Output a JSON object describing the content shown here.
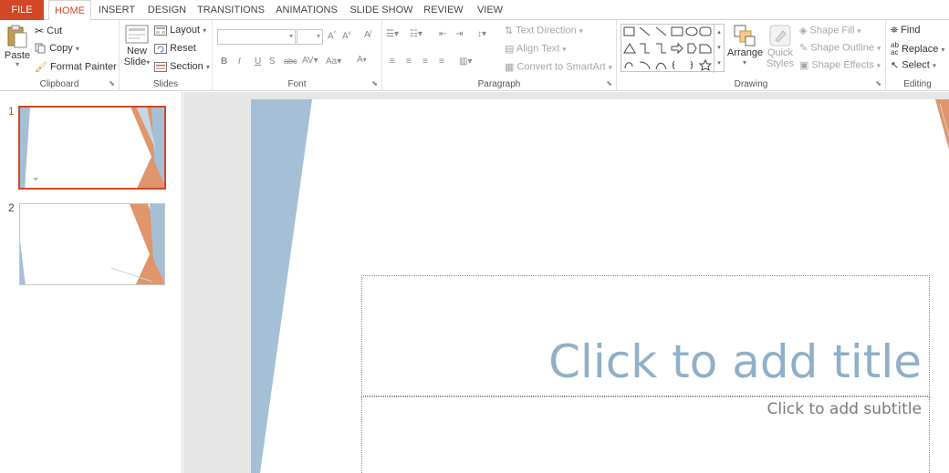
{
  "tabs": [
    "FILE",
    "HOME",
    "INSERT",
    "DESIGN",
    "TRANSITIONS",
    "ANIMATIONS",
    "SLIDE SHOW",
    "REVIEW",
    "VIEW"
  ],
  "active_tab": "HOME",
  "clipboard": {
    "label": "Clipboard",
    "paste": "Paste",
    "cut": "Cut",
    "copy": "Copy",
    "format_painter": "Format Painter"
  },
  "slides_group": {
    "label": "Slides",
    "new_slide_1": "New",
    "new_slide_2": "Slide",
    "layout": "Layout",
    "reset": "Reset",
    "section": "Section"
  },
  "font_group": {
    "label": "Font"
  },
  "paragraph_group": {
    "label": "Paragraph",
    "text_direction": "Text Direction",
    "align_text": "Align Text",
    "convert_smartart": "Convert to SmartArt"
  },
  "drawing_group": {
    "label": "Drawing",
    "arrange": "Arrange",
    "quick_styles_1": "Quick",
    "quick_styles_2": "Styles",
    "shape_fill": "Shape Fill",
    "shape_outline": "Shape Outline",
    "shape_effects": "Shape Effects"
  },
  "editing_group": {
    "label": "Editing",
    "find": "Find",
    "replace": "Replace",
    "select": "Select"
  },
  "thumbnails": [
    "1",
    "2"
  ],
  "slide": {
    "title_placeholder": "Click to add title",
    "subtitle_placeholder": "Click to add subtitle"
  },
  "colors": {
    "accent": "#d24726",
    "slide_blue": "#a5bfd6",
    "slide_orange": "#e0956a",
    "title_text": "#8fb0c8"
  }
}
